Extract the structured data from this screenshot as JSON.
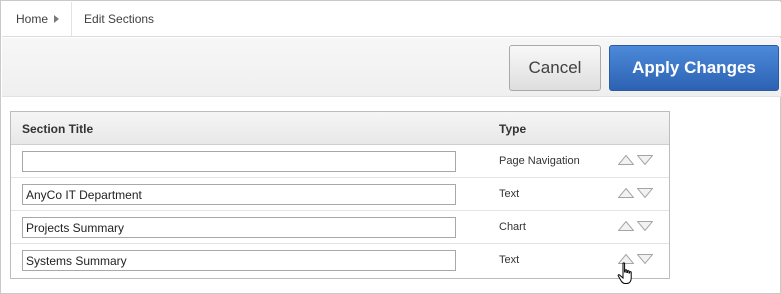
{
  "breadcrumb": {
    "home_label": "Home",
    "current_label": "Edit Sections"
  },
  "toolbar": {
    "cancel_label": "Cancel",
    "apply_label": "Apply Changes"
  },
  "table": {
    "headers": {
      "title": "Section Title",
      "type": "Type"
    },
    "rows": [
      {
        "title": "",
        "type": "Page Navigation"
      },
      {
        "title": "AnyCo IT Department",
        "type": "Text"
      },
      {
        "title": "Projects Summary",
        "type": "Chart"
      },
      {
        "title": "Systems Summary",
        "type": "Text"
      }
    ]
  },
  "icons": {
    "move_up": "triangle-up-icon",
    "move_down": "triangle-down-icon",
    "cursor": "hand-pointer-icon"
  },
  "colors": {
    "apply_button": "#2d62b3",
    "cancel_button": "#e6e6e6"
  }
}
